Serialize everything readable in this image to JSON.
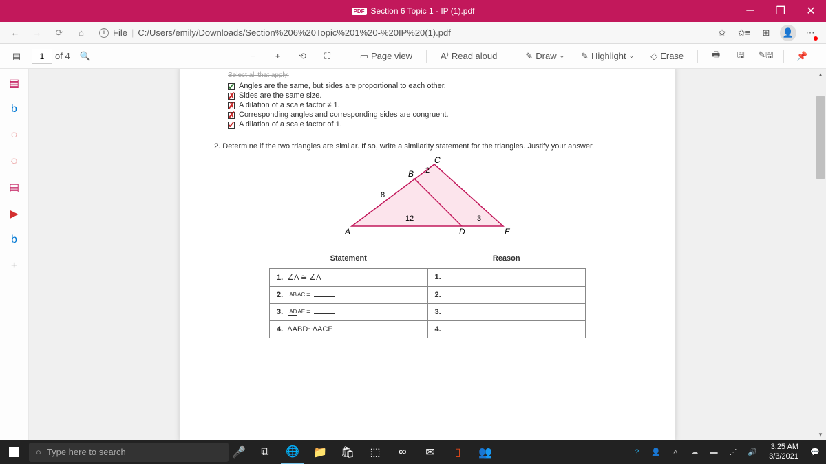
{
  "title_bar": {
    "filename": "Section 6 Topic 1 - IP (1).pdf",
    "badge": "PDF"
  },
  "address_bar": {
    "file_label": "File",
    "url": "C:/Users/emily/Downloads/Section%206%20Topic%201%20-%20IP%20(1).pdf"
  },
  "pdf_toolbar": {
    "current_page": "1",
    "of_label": "of 4",
    "page_view": "Page view",
    "read_aloud": "Read aloud",
    "draw": "Draw",
    "highlight": "Highlight",
    "erase": "Erase"
  },
  "document": {
    "select_header": "Select all that apply.",
    "checks": [
      {
        "mark": "checked",
        "text": "Angles are the same, but sides are proportional to each other."
      },
      {
        "mark": "crossed",
        "text": "Sides are the same size."
      },
      {
        "mark": "crossed",
        "text": "A dilation of a scale factor ≠ 1."
      },
      {
        "mark": "crossed",
        "text": "Corresponding angles and corresponding sides are congruent."
      },
      {
        "mark": "tick-red",
        "text": "A dilation of a scale factor of 1."
      }
    ],
    "q2_num": "2.",
    "q2_text": "Determine if the two triangles are similar. If so, write a similarity statement for the triangles. Justify your answer.",
    "tri": {
      "A": "A",
      "B": "B",
      "C": "C",
      "D": "D",
      "E": "E",
      "v8": "8",
      "v2": "2",
      "v12": "12",
      "v3": "3"
    },
    "table": {
      "h_statement": "Statement",
      "h_reason": "Reason",
      "rows": [
        {
          "sn": "1.",
          "stmt": "∠A ≅ ∠A",
          "rn": "1."
        },
        {
          "sn": "2.",
          "frac_top": "AB",
          "frac_bot": "AC",
          "eq": "=",
          "rn": "2."
        },
        {
          "sn": "3.",
          "frac_top": "AD",
          "frac_bot": "AE",
          "eq": "=",
          "rn": "3."
        },
        {
          "sn": "4.",
          "stmt": "ΔABD~ΔACE",
          "rn": "4."
        }
      ]
    }
  },
  "taskbar": {
    "search_placeholder": "Type here to search",
    "time": "3:25 AM",
    "date": "3/3/2021"
  }
}
